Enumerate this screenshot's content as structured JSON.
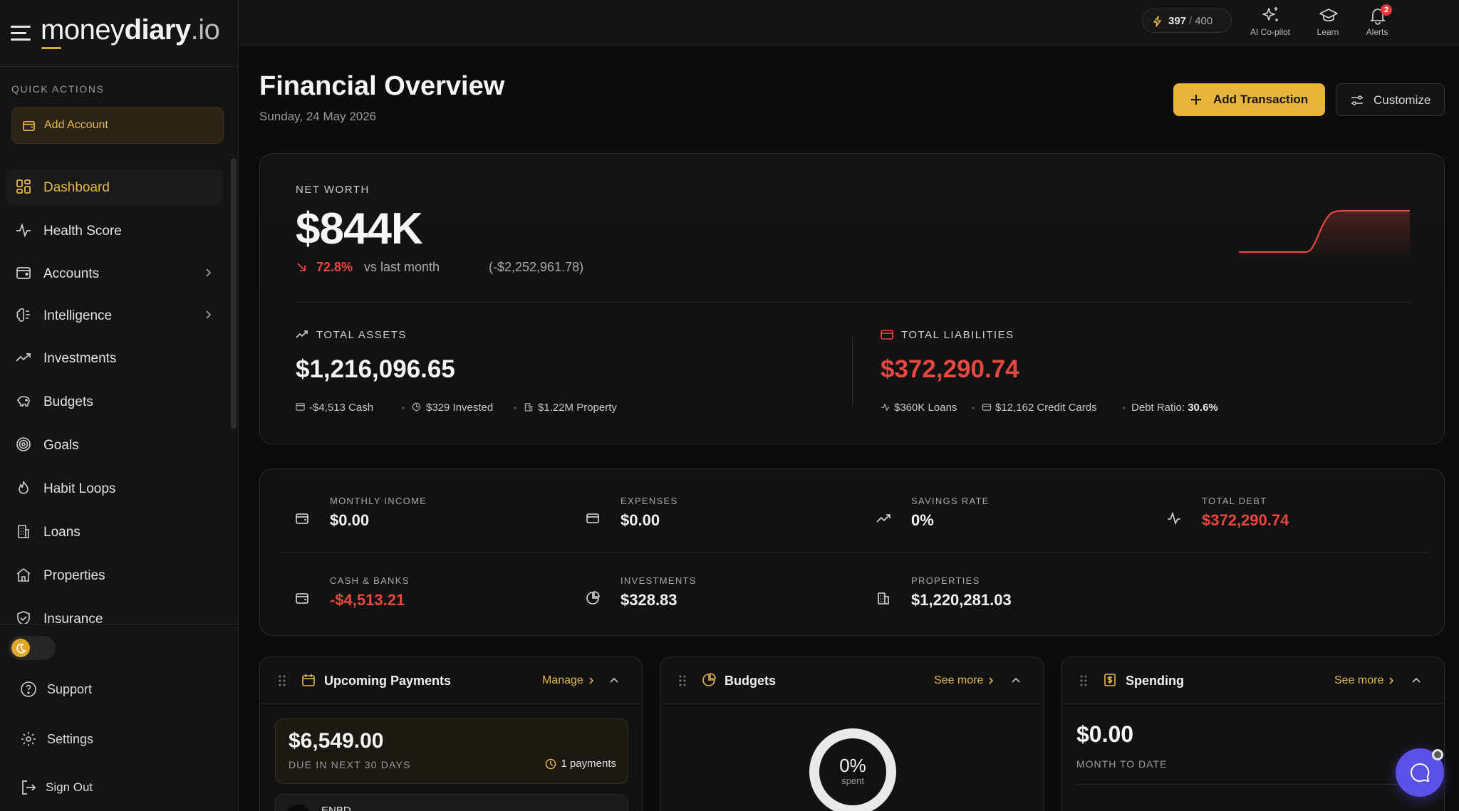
{
  "brand": {
    "name_a": "money",
    "name_b": "diary",
    "name_c": ".io"
  },
  "sidebar": {
    "quick_actions_title": "QUICK ACTIONS",
    "add_account_label": "Add Account",
    "items": [
      {
        "label": "Dashboard",
        "icon": "grid-icon",
        "active": true
      },
      {
        "label": "Health Score",
        "icon": "pulse-icon"
      },
      {
        "label": "Accounts",
        "icon": "wallet-icon",
        "has_children": true
      },
      {
        "label": "Intelligence",
        "icon": "brain-icon",
        "has_children": true
      },
      {
        "label": "Investments",
        "icon": "trending-up-icon"
      },
      {
        "label": "Budgets",
        "icon": "piggy-bank-icon"
      },
      {
        "label": "Goals",
        "icon": "target-icon"
      },
      {
        "label": "Habit Loops",
        "icon": "flame-icon"
      },
      {
        "label": "Loans",
        "icon": "building-icon"
      },
      {
        "label": "Properties",
        "icon": "home-icon"
      },
      {
        "label": "Insurance",
        "icon": "shield-icon"
      }
    ],
    "bottom": {
      "support_label": "Support",
      "settings_label": "Settings",
      "signout_label": "Sign Out"
    }
  },
  "topbar": {
    "credits_used": "397",
    "credits_sep": "/",
    "credits_total": "400",
    "copilot_label": "AI Co-pilot",
    "learn_label": "Learn",
    "alerts_label": "Alerts",
    "alerts_count": "2"
  },
  "header": {
    "title": "Financial Overview",
    "date": "Sunday, 24 May 2026",
    "add_transaction_label": "Add Transaction",
    "customize_label": "Customize"
  },
  "networth": {
    "label": "NET WORTH",
    "value": "$844K",
    "change_pct": "72.8%",
    "change_vs": "vs last month",
    "change_abs": "(-$2,252,961.78)",
    "assets_label": "TOTAL ASSETS",
    "assets_value": "$1,216,096.65",
    "assets_cash": "-$4,513 Cash",
    "assets_invested": "$329 Invested",
    "assets_property": "$1.22M Property",
    "liabilities_label": "TOTAL LIABILITIES",
    "liabilities_value": "$372,290.74",
    "liab_loans": "$360K Loans",
    "liab_cards": "$12,162 Credit Cards",
    "debt_ratio_label": "Debt Ratio:",
    "debt_ratio_value": "30.6%"
  },
  "metrics": {
    "monthly_income": {
      "label": "MONTHLY INCOME",
      "value": "$0.00"
    },
    "expenses": {
      "label": "EXPENSES",
      "value": "$0.00"
    },
    "savings_rate": {
      "label": "SAVINGS RATE",
      "value": "0%"
    },
    "total_debt": {
      "label": "TOTAL DEBT",
      "value": "$372,290.74"
    },
    "cash_banks": {
      "label": "CASH & BANKS",
      "value": "-$4,513.21"
    },
    "investments": {
      "label": "INVESTMENTS",
      "value": "$328.83"
    },
    "properties": {
      "label": "PROPERTIES",
      "value": "$1,220,281.03"
    }
  },
  "widgets": {
    "payments": {
      "title": "Upcoming Payments",
      "link": "Manage",
      "amount": "$6,549.00",
      "due_label": "DUE IN NEXT 30 DAYS",
      "count": "1 payments",
      "next_name": "ENBD"
    },
    "budgets": {
      "title": "Budgets",
      "link": "See more",
      "pct": "0%",
      "spent_label": "spent",
      "spent_fraction": 0
    },
    "spending": {
      "title": "Spending",
      "link": "See more",
      "amount": "$0.00",
      "label": "MONTH TO DATE"
    }
  },
  "colors": {
    "accent": "#e6b43a",
    "negative": "#e5483f",
    "chat": "#5a52e8"
  }
}
